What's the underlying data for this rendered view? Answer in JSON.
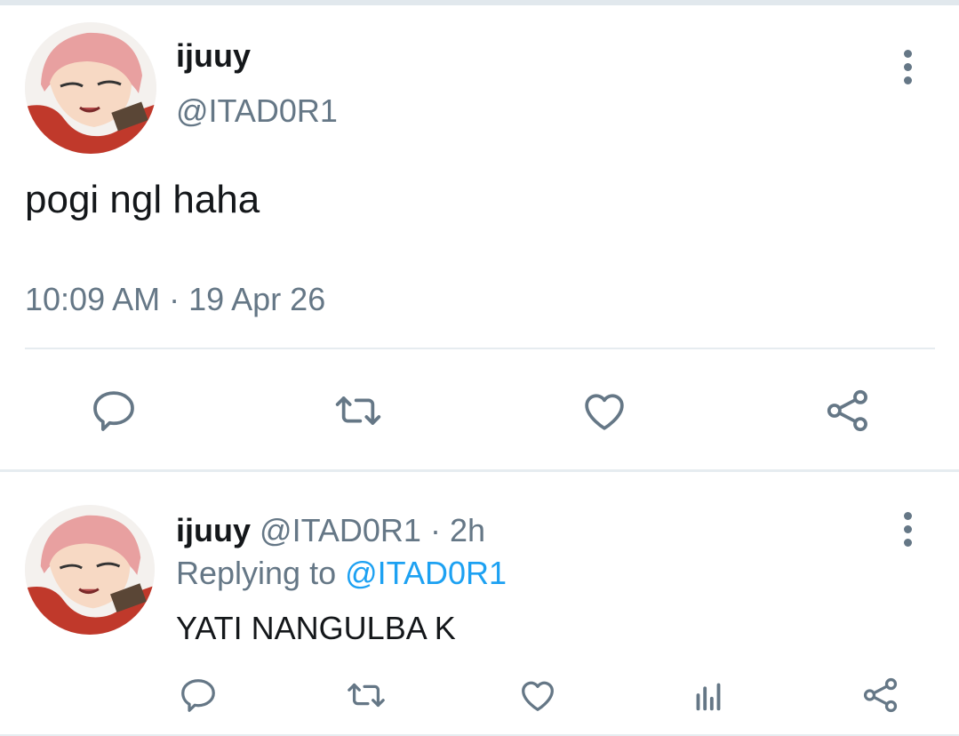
{
  "main_tweet": {
    "display_name": "ijuuy",
    "handle": "@ITAD0R1",
    "text": "pogi ngl haha",
    "timestamp": "10:09 AM · 19 Apr 26"
  },
  "reply": {
    "display_name": "ijuuy",
    "handle_time": "@ITAD0R1 · 2h",
    "replying_prefix": "Replying to",
    "replying_to": "@ITAD0R1",
    "text": "YATI NANGULBA K"
  },
  "icons": {
    "main_actions": [
      "reply-icon",
      "retweet-icon",
      "like-icon",
      "share-icon"
    ],
    "reply_actions": [
      "reply-icon",
      "retweet-icon",
      "like-icon",
      "analytics-icon",
      "share-icon"
    ],
    "menu": "more-vertical-icon"
  },
  "colors": {
    "text": "#14171a",
    "secondary": "#657786",
    "link": "#1da1f2",
    "divider": "#e6ecf0"
  }
}
